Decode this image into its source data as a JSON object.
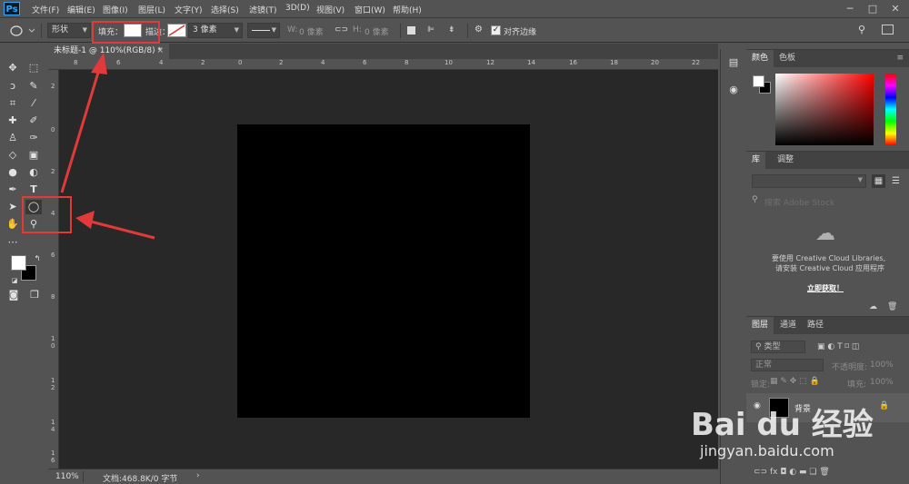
{
  "menubar": {
    "logo": "Ps",
    "items": [
      "文件(F)",
      "编辑(E)",
      "图像(I)",
      "图层(L)",
      "文字(Y)",
      "选择(S)",
      "滤镜(T)",
      "3D(D)",
      "视图(V)",
      "窗口(W)",
      "帮助(H)"
    ]
  },
  "options": {
    "mode": "形状",
    "fill_label": "填充：",
    "stroke_label": "描边：",
    "stroke_size": "3 像素",
    "w_label": "W:",
    "w_value": "0 像素",
    "h_label": "H:",
    "h_value": "0 像素",
    "align_edges": "对齐边缘"
  },
  "document": {
    "tab_title": "未标题-1 @ 110%(RGB/8) *",
    "zoom": "110%",
    "doc_info": "文档:468.8K/0 字节"
  },
  "ruler": {
    "top": [
      "8",
      "6",
      "4",
      "2",
      "0",
      "2",
      "4",
      "6",
      "8",
      "10",
      "12",
      "14",
      "16",
      "18",
      "20",
      "22"
    ],
    "left": [
      "2",
      "0",
      "2",
      "4",
      "6",
      "8",
      "1",
      "0",
      "1",
      "2",
      "1",
      "4",
      "1",
      "6"
    ]
  },
  "color_panel": {
    "tab_color": "颜色",
    "tab_swatches": "色板"
  },
  "library_panel": {
    "tab_library": "库",
    "tab_adjust": "调整",
    "search_placeholder": "搜索 Adobe Stock",
    "message_line1": "要使用 Creative Cloud Libraries,",
    "message_line2": "请安装 Creative Cloud 应用程序",
    "link": "立即获取！"
  },
  "layers_panel": {
    "tab_layers": "图层",
    "tab_channels": "通道",
    "tab_paths": "路径",
    "kind": "类型",
    "blend_mode": "正常",
    "opacity_label": "不透明度:",
    "opacity_value": "100%",
    "lock_label": "锁定:",
    "fill_label": "填充:",
    "fill_value": "100%",
    "layer_name": "背景"
  },
  "watermark": {
    "brand": "Bai du 经验",
    "url": "jingyan.baidu.com"
  },
  "colors": {
    "annotation_red": "#e23a3a",
    "canvas_black": "#000000",
    "ps_blue": "#31a8ff"
  }
}
